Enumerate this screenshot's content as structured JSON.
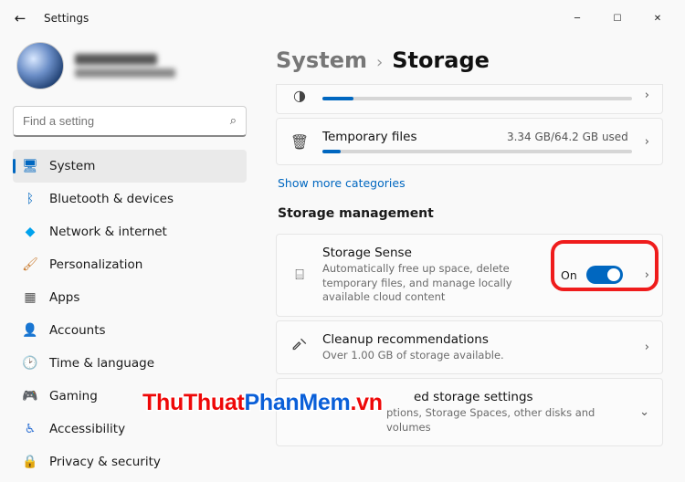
{
  "titlebar": {
    "title": "Settings"
  },
  "search": {
    "placeholder": "Find a setting"
  },
  "nav": [
    {
      "label": "System",
      "icon": "🖥",
      "color": "#0067c0",
      "active": true
    },
    {
      "label": "Bluetooth & devices",
      "icon": "ᛒ",
      "color": "#0067c0"
    },
    {
      "label": "Network & internet",
      "icon": "◆",
      "color": "#00a2ed"
    },
    {
      "label": "Personalization",
      "icon": "🖌",
      "color": "#c97b2e"
    },
    {
      "label": "Apps",
      "icon": "▦",
      "color": "#555"
    },
    {
      "label": "Accounts",
      "icon": "👤",
      "color": "#6b6b6b"
    },
    {
      "label": "Time & language",
      "icon": "🕑",
      "color": "#444"
    },
    {
      "label": "Gaming",
      "icon": "🎮",
      "color": "#555"
    },
    {
      "label": "Accessibility",
      "icon": "♿",
      "color": "#3c7ad6"
    },
    {
      "label": "Privacy & security",
      "icon": "🔒",
      "color": "#555"
    }
  ],
  "breadcrumb": {
    "parent": "System",
    "current": "Storage"
  },
  "temp_files": {
    "title": "Temporary files",
    "usage": "3.34 GB/64.2 GB used"
  },
  "show_more": "Show more categories",
  "section": "Storage management",
  "storage_sense": {
    "title": "Storage Sense",
    "desc": "Automatically free up space, delete temporary files, and manage locally available cloud content",
    "state_label": "On"
  },
  "cleanup": {
    "title": "Cleanup recommendations",
    "desc": "Over 1.00 GB of storage available."
  },
  "advanced": {
    "title_obscured": "ed storage settings",
    "desc_obscured": "ptions, Storage Spaces, other disks and volumes"
  },
  "watermark": {
    "t1": "ThuThuat",
    "t2": "PhanMem",
    "t3": ".vn"
  }
}
